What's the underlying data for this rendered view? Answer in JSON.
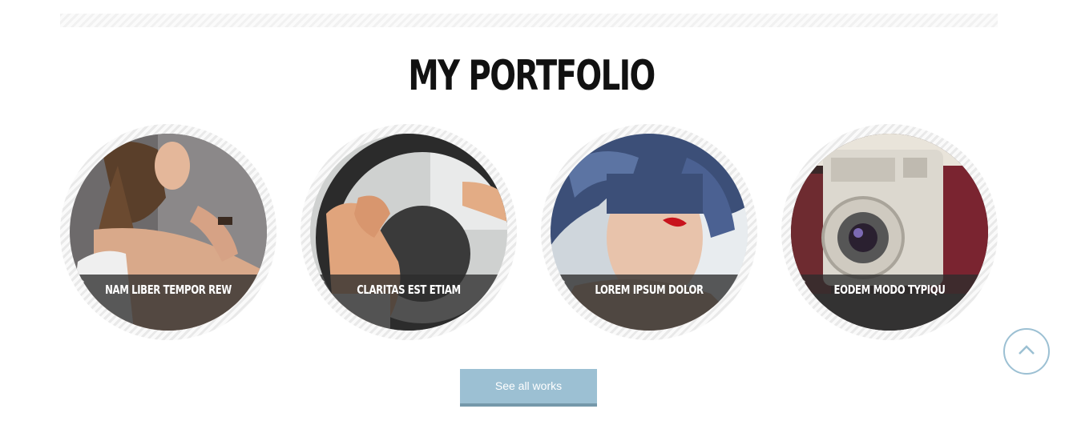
{
  "section": {
    "title": "MY PORTFOLIO"
  },
  "portfolio": {
    "items": [
      {
        "label": "NAM LIBER TEMPOR REW",
        "icon": "share-arrow-icon",
        "image": "woman-portrait"
      },
      {
        "label": "CLARITAS EST ETIAM",
        "icon": "share-arrow-icon",
        "image": "steering-wheel"
      },
      {
        "label": "LOREM IPSUM DOLOR",
        "icon": "share-arrow-icon",
        "image": "feather-woman"
      },
      {
        "label": "EODEM MODO TYPIQU",
        "icon": "share-arrow-icon",
        "image": "vintage-camera"
      }
    ]
  },
  "actions": {
    "see_all_label": "See all works"
  },
  "colors": {
    "accent": "#9cc0d3",
    "accent_dark": "#7598aa",
    "caption_bg": "#2d2d2d",
    "title": "#111111"
  },
  "scroll_top": {
    "icon": "chevron-up-icon"
  }
}
